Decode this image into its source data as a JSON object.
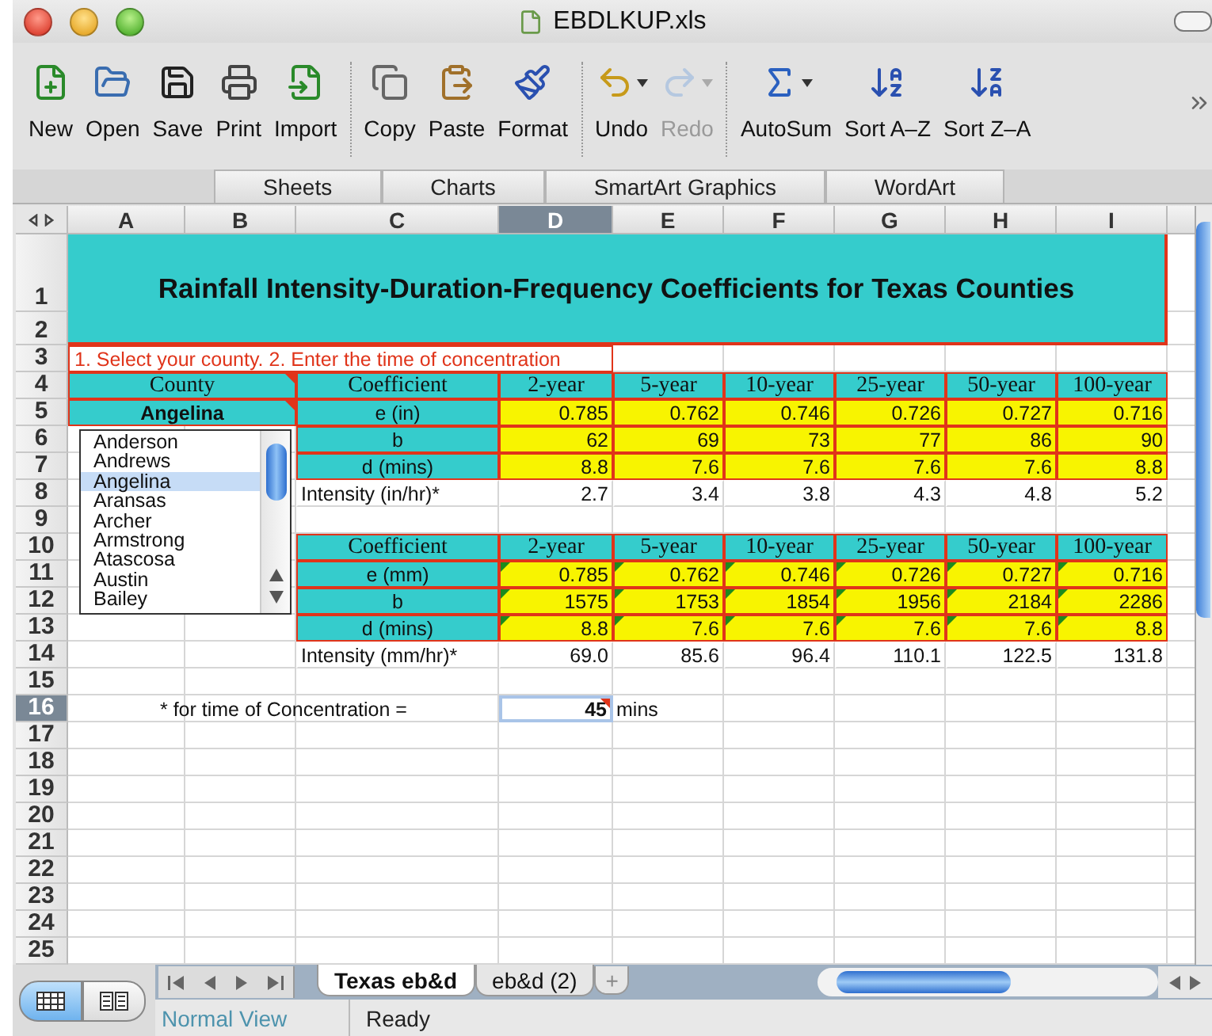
{
  "window": {
    "title": "EBDLKUP.xls"
  },
  "toolbar": [
    {
      "items": [
        {
          "label": "New",
          "kind": "new",
          "disabled": false,
          "menu": false
        },
        {
          "label": "Open",
          "kind": "open",
          "disabled": false,
          "menu": false
        },
        {
          "label": "Save",
          "kind": "save",
          "disabled": false,
          "menu": false
        },
        {
          "label": "Print",
          "kind": "print",
          "disabled": false,
          "menu": false
        },
        {
          "label": "Import",
          "kind": "import",
          "disabled": false,
          "menu": false
        }
      ]
    },
    {
      "items": [
        {
          "label": "Copy",
          "kind": "copy",
          "disabled": false,
          "menu": false
        },
        {
          "label": "Paste",
          "kind": "paste",
          "disabled": false,
          "menu": false
        },
        {
          "label": "Format",
          "kind": "format",
          "disabled": false,
          "menu": false
        }
      ]
    },
    {
      "items": [
        {
          "label": "Undo",
          "kind": "undo",
          "disabled": false,
          "menu": true
        },
        {
          "label": "Redo",
          "kind": "redo",
          "disabled": true,
          "menu": true
        }
      ]
    },
    {
      "items": [
        {
          "label": "AutoSum",
          "kind": "sum",
          "disabled": false,
          "menu": true
        },
        {
          "label": "Sort A–Z",
          "kind": "sort_az",
          "disabled": false,
          "menu": false
        },
        {
          "label": "Sort Z–A",
          "kind": "sort_za",
          "disabled": false,
          "menu": false
        }
      ]
    }
  ],
  "ribbon_tabs": [
    {
      "label": "Sheets",
      "selected": false
    },
    {
      "label": "Charts",
      "selected": false
    },
    {
      "label": "SmartArt Graphics",
      "selected": false
    },
    {
      "label": "WordArt",
      "selected": false
    }
  ],
  "sheet": {
    "columns": [
      {
        "label": "A",
        "selected": false
      },
      {
        "label": "B",
        "selected": false
      },
      {
        "label": "C",
        "selected": false
      },
      {
        "label": "D",
        "selected": true
      },
      {
        "label": "E",
        "selected": false
      },
      {
        "label": "F",
        "selected": false
      },
      {
        "label": "G",
        "selected": false
      },
      {
        "label": "H",
        "selected": false
      },
      {
        "label": "I",
        "selected": false
      }
    ],
    "rows": [
      {
        "label": "1",
        "selected": false
      },
      {
        "label": "2",
        "selected": false
      },
      {
        "label": "3",
        "selected": false
      },
      {
        "label": "4",
        "selected": false
      },
      {
        "label": "5",
        "selected": false
      },
      {
        "label": "6",
        "selected": false
      },
      {
        "label": "7",
        "selected": false
      },
      {
        "label": "8",
        "selected": false
      },
      {
        "label": "9",
        "selected": false
      },
      {
        "label": "10",
        "selected": false
      },
      {
        "label": "11",
        "selected": false
      },
      {
        "label": "12",
        "selected": false
      },
      {
        "label": "13",
        "selected": false
      },
      {
        "label": "14",
        "selected": false
      },
      {
        "label": "15",
        "selected": false
      },
      {
        "label": "16",
        "selected": true
      },
      {
        "label": "17",
        "selected": false
      },
      {
        "label": "18",
        "selected": false
      },
      {
        "label": "19",
        "selected": false
      },
      {
        "label": "20",
        "selected": false
      },
      {
        "label": "21",
        "selected": false
      },
      {
        "label": "22",
        "selected": false
      },
      {
        "label": "23",
        "selected": false
      },
      {
        "label": "24",
        "selected": false
      },
      {
        "label": "25",
        "selected": false
      }
    ],
    "title": "Rainfall Intensity-Duration-Frequency Coefficients for Texas Counties",
    "instruction": "1. Select your county.  2. Enter the time of concentration",
    "county": {
      "header": {
        "text": "County",
        "note": true
      },
      "value": {
        "text": "Angelina",
        "note": true
      },
      "list": [
        {
          "label": "Anderson",
          "selected": false
        },
        {
          "label": "Andrews",
          "selected": false
        },
        {
          "label": "Angelina",
          "selected": true
        },
        {
          "label": "Aransas",
          "selected": false
        },
        {
          "label": "Archer",
          "selected": false
        },
        {
          "label": "Armstrong",
          "selected": false
        },
        {
          "label": "Atascosa",
          "selected": false
        },
        {
          "label": "Austin",
          "selected": false
        },
        {
          "label": "Bailey",
          "selected": false
        }
      ]
    },
    "tables": [
      {
        "header": [
          "Coefficient",
          "2-year",
          "5-year",
          "10-year",
          "25-year",
          "50-year",
          "100-year"
        ],
        "notes": false,
        "rows": [
          {
            "label": "e (in)",
            "values": [
              "0.785",
              "0.762",
              "0.746",
              "0.726",
              "0.727",
              "0.716"
            ]
          },
          {
            "label": "b",
            "values": [
              "62",
              "69",
              "73",
              "77",
              "86",
              "90"
            ]
          },
          {
            "label": "d (mins)",
            "values": [
              "8.8",
              "7.6",
              "7.6",
              "7.6",
              "7.6",
              "8.8"
            ]
          }
        ],
        "intensity": {
          "label": "Intensity (in/hr)*",
          "values": [
            "2.7",
            "3.4",
            "3.8",
            "4.3",
            "4.8",
            "5.2"
          ]
        }
      },
      {
        "header": [
          "Coefficient",
          "2-year",
          "5-year",
          "10-year",
          "25-year",
          "50-year",
          "100-year"
        ],
        "notes": true,
        "rows": [
          {
            "label": "e (mm)",
            "values": [
              "0.785",
              "0.762",
              "0.746",
              "0.726",
              "0.727",
              "0.716"
            ]
          },
          {
            "label": "b",
            "values": [
              "1575",
              "1753",
              "1854",
              "1956",
              "2184",
              "2286"
            ]
          },
          {
            "label": "d (mins)",
            "values": [
              "8.8",
              "7.6",
              "7.6",
              "7.6",
              "7.6",
              "8.8"
            ]
          }
        ],
        "intensity": {
          "label": "Intensity (mm/hr)*",
          "values": [
            "69.0",
            "85.6",
            "96.4",
            "110.1",
            "122.5",
            "131.8"
          ]
        }
      }
    ],
    "time": {
      "label": "* for time of Concentration =",
      "value": "45",
      "unit": "mins",
      "selected": true,
      "note": true
    }
  },
  "view_buttons": [
    {
      "kind": "normal",
      "selected": true
    },
    {
      "kind": "layout",
      "selected": false
    }
  ],
  "sheet_tabs": {
    "tabs": [
      {
        "label": "Texas eb&d",
        "selected": true
      },
      {
        "label": "eb&d (2)",
        "selected": false
      }
    ],
    "add": "+"
  },
  "status_bar": {
    "view": "Normal View",
    "state": "Ready"
  }
}
